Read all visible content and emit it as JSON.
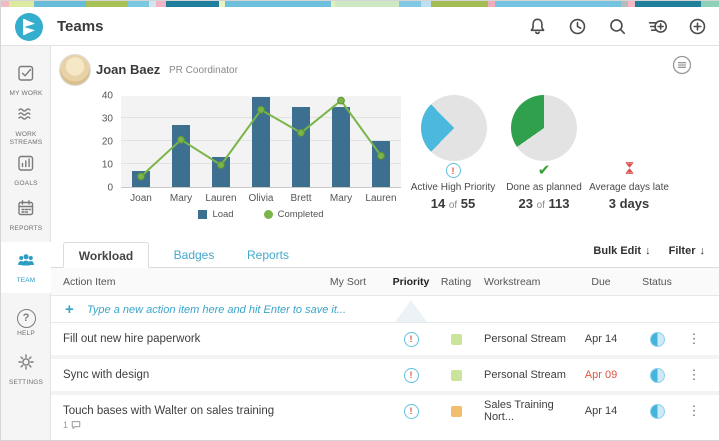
{
  "header": {
    "title": "Teams",
    "icons": [
      "bell-icon",
      "history-clock-icon",
      "search-icon",
      "quick-add-icon",
      "add-icon"
    ]
  },
  "colors": {
    "accent_blue": "#35aecd",
    "bar_blue": "#3d6f91",
    "line_green": "#79b548",
    "pie_blue": "#4bb9de",
    "pie_green": "#2fa14c",
    "overdue_red": "#e25544"
  },
  "sidebar": {
    "items": [
      {
        "label": "MY WORK",
        "icon": "checkbox-icon"
      },
      {
        "label": "WORK STREAMS",
        "icon": "waves-icon"
      },
      {
        "label": "GOALS",
        "icon": "bar-chart-icon"
      },
      {
        "label": "REPORTS",
        "icon": "calendar-icon"
      },
      {
        "label": "TEAM",
        "icon": "people-icon",
        "active": true
      },
      {
        "label": "HELP",
        "icon": "question-icon"
      },
      {
        "label": "SETTINGS",
        "icon": "gear-icon"
      }
    ]
  },
  "profile": {
    "name": "Joan Baez",
    "role": "PR Coordinator"
  },
  "chart_data": [
    {
      "type": "bar",
      "categories": [
        "Joan",
        "Mary",
        "Lauren",
        "Olivia",
        "Brett",
        "Mary",
        "Lauren"
      ],
      "series": [
        {
          "name": "Load",
          "type": "bar",
          "color": "#3d6f91",
          "values": [
            7,
            27,
            13,
            39,
            35,
            35,
            20
          ]
        },
        {
          "name": "Completed",
          "type": "line",
          "color": "#79b548",
          "values": [
            5,
            21,
            10,
            34,
            24,
            38,
            14
          ]
        }
      ],
      "ylim": [
        0,
        40
      ],
      "yticks": [
        0,
        10,
        20,
        30,
        40
      ],
      "legend_position": "bottom",
      "grid": true
    },
    {
      "type": "pie",
      "label": "Active High Priority",
      "value_text": "14 of 55",
      "fraction": 0.255,
      "start_deg": 224,
      "color": "#4bb9de",
      "track": "#e3e3e3"
    },
    {
      "type": "pie",
      "label": "Done as planned",
      "value_text": "23 of 113",
      "fraction": 0.347,
      "start_deg": 235,
      "color": "#2fa14c",
      "track": "#e3e3e3"
    }
  ],
  "metrics": [
    {
      "label": "Active High Priority",
      "value": "14",
      "of": "of",
      "total": "55",
      "icon": "priority-exclamation-icon"
    },
    {
      "label": "Done as planned",
      "value": "23",
      "of": "of",
      "total": "113",
      "icon": "check-icon"
    },
    {
      "label": "Average days late",
      "value": "3 days",
      "of": "",
      "total": "",
      "icon": "hourglass-icon"
    }
  ],
  "tabs": [
    {
      "label": "Workload",
      "active": true
    },
    {
      "label": "Badges",
      "active": false
    },
    {
      "label": "Reports",
      "active": false
    }
  ],
  "toolbar": {
    "bulk_edit": "Bulk Edit",
    "filter": "Filter"
  },
  "table": {
    "columns": [
      "Action Item",
      "My Sort",
      "Priority",
      "Rating",
      "Workstream",
      "Due",
      "Status"
    ],
    "new_item_placeholder": "Type a new action item here and hit Enter to save it...",
    "rows": [
      {
        "title": "Fill out new hire paperwork",
        "priority": "high",
        "rating_color": "#cbe49c",
        "workstream": "Personal Stream",
        "due": "Apr 14",
        "due_color": "#3e3e3e",
        "status": "in-progress",
        "comments": ""
      },
      {
        "title": "Sync with design",
        "priority": "high",
        "rating_color": "#cbe49c",
        "workstream": "Personal Stream",
        "due": "Apr 09",
        "due_color": "#e25544",
        "status": "in-progress",
        "comments": ""
      },
      {
        "title": "Touch bases with Walter on sales training",
        "priority": "high",
        "rating_color": "#f3bd70",
        "workstream": "Sales Training Nort...",
        "due": "Apr 14",
        "due_color": "#3e3e3e",
        "status": "in-progress",
        "comments": "1"
      }
    ]
  },
  "glyphs": {
    "exclamation": "!",
    "check": "✔",
    "kebab": "⋮",
    "plus": "+",
    "arrow_down": "↓",
    "question": "?"
  }
}
